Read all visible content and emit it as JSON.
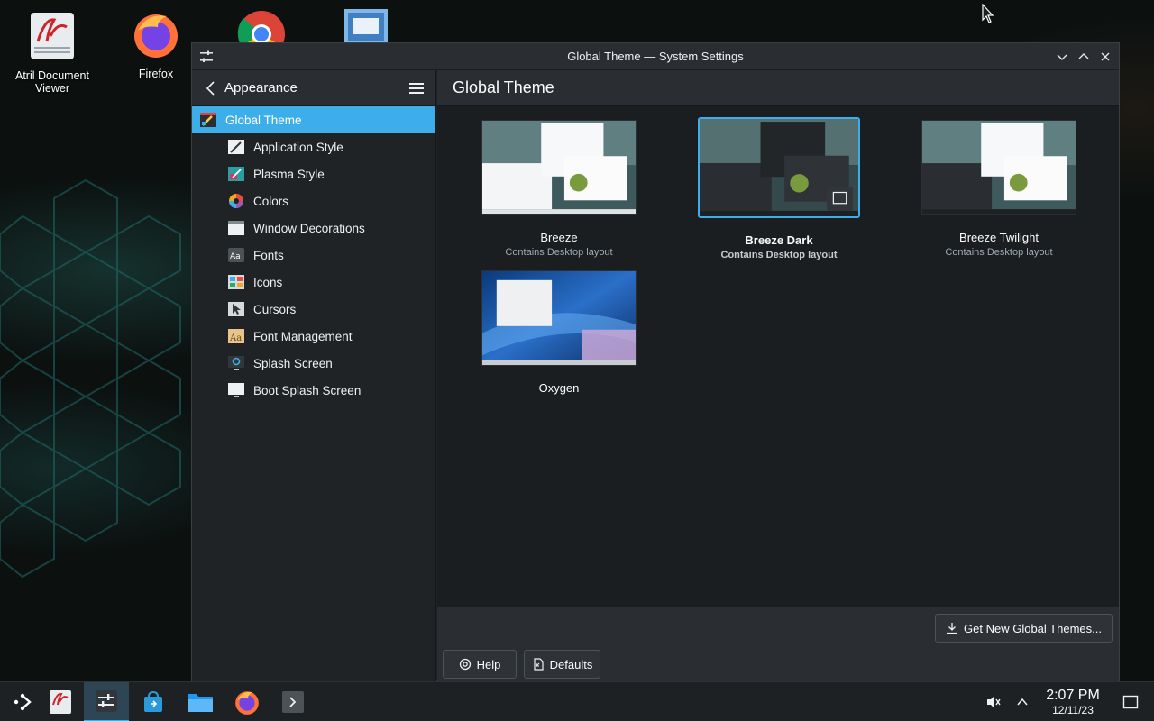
{
  "desktop": {
    "icons": [
      {
        "name": "atril",
        "label": "Atril Document Viewer"
      },
      {
        "name": "firefox",
        "label": "Firefox"
      },
      {
        "name": "chrome",
        "label": ""
      },
      {
        "name": "screenshot",
        "label": ""
      }
    ]
  },
  "window": {
    "title": "Global Theme — System Settings"
  },
  "sidebar": {
    "back_label": "Appearance",
    "items": [
      {
        "label": "Global Theme",
        "icon": "global-theme-icon",
        "selected": true
      },
      {
        "label": "Application Style",
        "icon": "application-style-icon"
      },
      {
        "label": "Plasma Style",
        "icon": "plasma-style-icon"
      },
      {
        "label": "Colors",
        "icon": "colors-icon"
      },
      {
        "label": "Window Decorations",
        "icon": "window-decorations-icon"
      },
      {
        "label": "Fonts",
        "icon": "fonts-icon"
      },
      {
        "label": "Icons",
        "icon": "icons-icon"
      },
      {
        "label": "Cursors",
        "icon": "cursors-icon"
      },
      {
        "label": "Font Management",
        "icon": "font-management-icon"
      },
      {
        "label": "Splash Screen",
        "icon": "splash-screen-icon"
      },
      {
        "label": "Boot Splash Screen",
        "icon": "boot-splash-screen-icon"
      }
    ]
  },
  "main": {
    "title": "Global Theme",
    "themes": [
      {
        "name": "Breeze",
        "sub": "Contains Desktop layout"
      },
      {
        "name": "Breeze Dark",
        "sub": "Contains Desktop layout",
        "selected": true
      },
      {
        "name": "Breeze Twilight",
        "sub": "Contains Desktop layout"
      },
      {
        "name": "Oxygen",
        "sub": ""
      }
    ],
    "get_new_label": "Get New Global Themes...",
    "help_label": "Help",
    "defaults_label": "Defaults"
  },
  "taskbar": {
    "time": "2:07 PM",
    "date": "12/11/23"
  },
  "colors": {
    "accent": "#3daee9",
    "window_bg": "#202326",
    "content_bg": "#1b1e20"
  }
}
